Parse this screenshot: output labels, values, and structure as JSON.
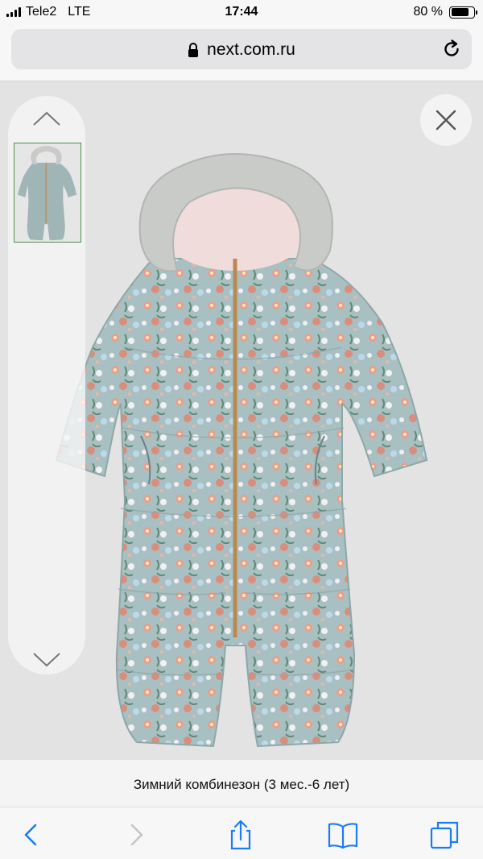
{
  "status_bar": {
    "carrier": "Tele2",
    "network": "LTE",
    "time": "17:44",
    "battery_text": "80 %",
    "battery_level": 0.8
  },
  "address_bar": {
    "url": "next.com.ru",
    "lock_icon": "lock-icon",
    "reload_icon": "reload-icon"
  },
  "viewer": {
    "thumbnails": [
      {
        "alt": "snowsuit-thumbnail",
        "selected": true
      }
    ],
    "up_icon": "chevron-up-icon",
    "down_icon": "chevron-down-icon",
    "close_icon": "close-icon"
  },
  "caption": {
    "text": "Зимний комбинезон (3 мес.-6 лет)"
  },
  "toolbar": {
    "items": [
      "back-icon",
      "forward-icon",
      "share-icon",
      "bookmarks-icon",
      "tabs-icon"
    ]
  },
  "colors": {
    "accent": "#1a7cf5",
    "disabled": "#c5c5c8",
    "thumb_border": "#4f8f4f"
  }
}
